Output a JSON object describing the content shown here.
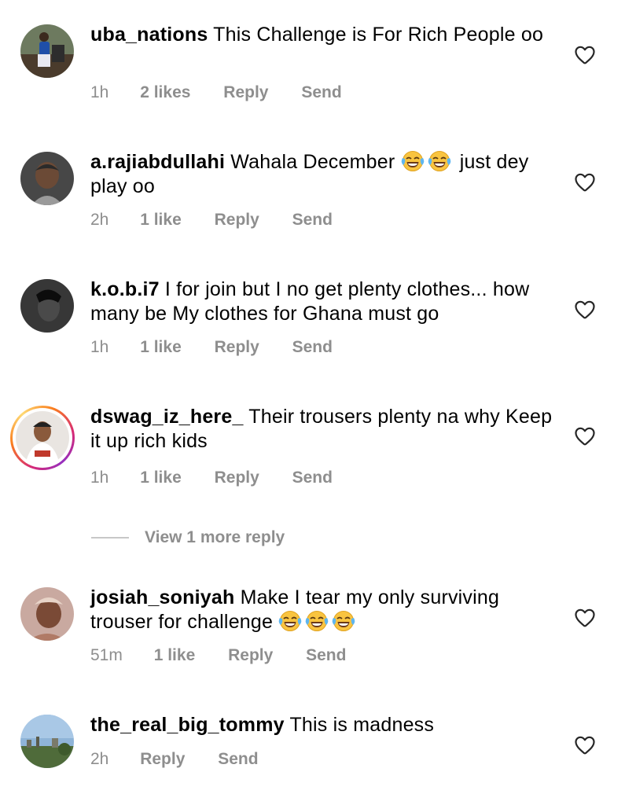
{
  "comments": [
    {
      "username": "uba_nations",
      "text": "This Challenge is For Rich People oo",
      "time": "1h",
      "likes": "2 likes",
      "reply": "Reply",
      "send": "Send"
    },
    {
      "username": "a.rajiabdullahi",
      "text_before": "Wahala December",
      "text_after": "just dey play oo",
      "emoji": "face-with-tears-of-joy",
      "time": "2h",
      "likes": "1 like",
      "reply": "Reply",
      "send": "Send"
    },
    {
      "username": "k.o.b.i7",
      "text": "I for join but I no get plenty clothes... how many be My clothes for Ghana must go",
      "time": "1h",
      "likes": "1 like",
      "reply": "Reply",
      "send": "Send"
    },
    {
      "username": "dswag_iz_here_",
      "text": "Their trousers plenty na why Keep it up rich kids",
      "time": "1h",
      "likes": "1 like",
      "reply": "Reply",
      "send": "Send"
    },
    {
      "username": "josiah_soniyah",
      "text": "Make I tear my only surviving trouser for challenge",
      "emoji": "face-with-tears-of-joy",
      "time": "51m",
      "likes": "1 like",
      "reply": "Reply",
      "send": "Send"
    },
    {
      "username": "the_real_big_tommy",
      "text": "This is madness",
      "time": "2h",
      "reply": "Reply",
      "send": "Send"
    }
  ],
  "view_more": {
    "label": "View 1 more reply"
  },
  "colors": {
    "text": "#000000",
    "meta": "#8e8e8e",
    "divider": "#c7c7c7",
    "emoji_face": "#f9c440",
    "story_ring": "#d62976"
  },
  "icons": {
    "like": "heart-outline-icon",
    "emoji": "face-with-tears-of-joy"
  }
}
